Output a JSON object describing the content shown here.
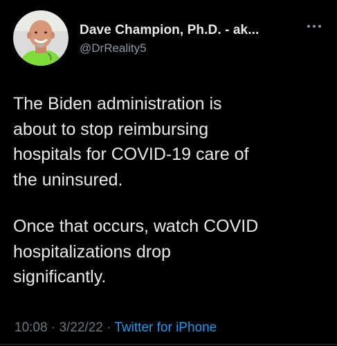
{
  "author": {
    "display_name": "Dave Champion, Ph.D. - ak...",
    "handle": "@DrReality5",
    "avatar_icon": "profile-avatar-icon"
  },
  "more_icon": "more-options-icon",
  "tweet": {
    "paragraph_1": "The Biden administration is\nabout to stop reimbursing\nhospitals for COVID-19 care of\nthe uninsured.",
    "paragraph_2": "Once that occurs, watch COVID\nhospitalizations drop\nsignificantly."
  },
  "meta": {
    "time": "10:08",
    "separator": " · ",
    "date": "3/22/22",
    "source": "Twitter for iPhone"
  },
  "colors": {
    "background": "#000000",
    "text": "#e7e9ea",
    "secondary": "#8b98a5",
    "link": "#1d9bf0"
  }
}
